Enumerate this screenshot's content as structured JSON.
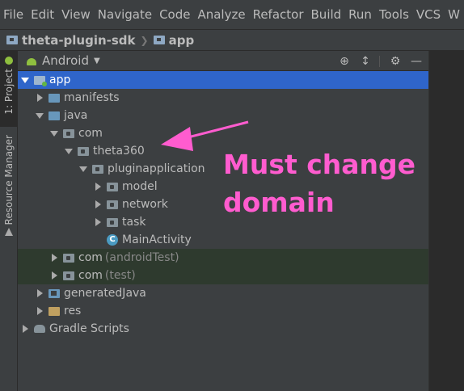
{
  "menu": [
    "File",
    "Edit",
    "View",
    "Navigate",
    "Code",
    "Analyze",
    "Refactor",
    "Build",
    "Run",
    "Tools",
    "VCS",
    "W"
  ],
  "breadcrumb": {
    "project": "theta-plugin-sdk",
    "module": "app"
  },
  "left_strip": {
    "project_tab": "1: Project",
    "resource_tab": "Resource Manager"
  },
  "panel": {
    "view_mode": "Android",
    "icons": [
      "locate-icon",
      "collapse-icon",
      "gear-icon",
      "minimize-icon"
    ]
  },
  "tree": {
    "app": "app",
    "manifests": "manifests",
    "java": "java",
    "com": "com",
    "theta360": "theta360",
    "pluginapplication": "pluginapplication",
    "model": "model",
    "network": "network",
    "task": "task",
    "main_activity": "MainActivity",
    "com_android_test": "com",
    "android_test_suffix": "(androidTest)",
    "com_test": "com",
    "test_suffix": "(test)",
    "generated_java": "generatedJava",
    "res": "res",
    "gradle_scripts": "Gradle Scripts"
  },
  "annotation": {
    "line1": "Must change",
    "line2": "domain",
    "color": "#ff5ccf"
  },
  "colors": {
    "selection": "#2f65ca",
    "background": "#3c3f41",
    "test_background": "#2e3a2e"
  }
}
